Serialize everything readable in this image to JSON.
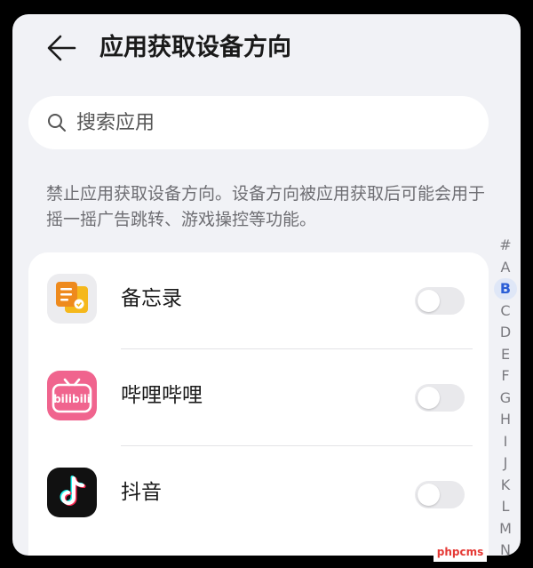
{
  "header": {
    "title": "应用获取设备方向",
    "back_icon": "arrow-left-icon"
  },
  "search": {
    "placeholder": "搜索应用",
    "value": "",
    "icon": "search-icon"
  },
  "description": "禁止应用获取设备方向。设备方向被应用获取后可能会用于摇一摇广告跳转、游戏操控等功能。",
  "apps": [
    {
      "name": "备忘录",
      "icon": "notepad-icon",
      "enabled": false
    },
    {
      "name": "哔哩哔哩",
      "icon": "bilibili-icon",
      "enabled": false
    },
    {
      "name": "抖音",
      "icon": "douyin-icon",
      "enabled": false
    }
  ],
  "alpha_index": {
    "letters": [
      "#",
      "A",
      "B",
      "C",
      "D",
      "E",
      "F",
      "G",
      "H",
      "I",
      "J",
      "K",
      "L",
      "M",
      "N"
    ],
    "active": "B"
  },
  "watermark": "phpcms",
  "colors": {
    "background": "#f1f2f6",
    "card": "#ffffff",
    "accent": "#2c5fd6",
    "toggle_off": "#e9e9ec"
  }
}
